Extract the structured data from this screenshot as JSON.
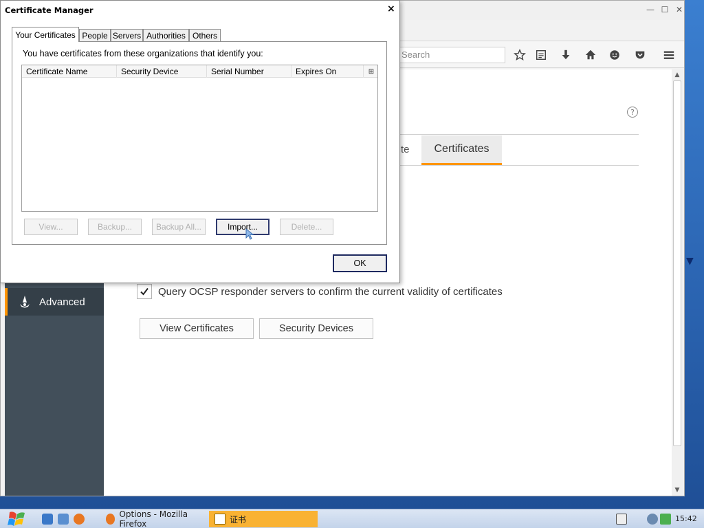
{
  "firefox": {
    "search_placeholder": "Search",
    "sidebar": {
      "advanced_label": "Advanced"
    },
    "tabs": {
      "partial_label": "te",
      "certificates_label": "Certificates"
    },
    "help_glyph": "?",
    "ocsp_label": "Query OCSP responder servers to confirm the current validity of certificates",
    "ocsp_checked": true,
    "buttons": {
      "view_certificates": "View Certificates",
      "security_devices": "Security Devices"
    }
  },
  "dialog": {
    "title": "Certificate Manager",
    "close_glyph": "×",
    "tabs": [
      "Your Certificates",
      "People",
      "Servers",
      "Authorities",
      "Others"
    ],
    "intro": "You have certificates from these organizations that identify you:",
    "columns": [
      "Certificate Name",
      "Security Device",
      "Serial Number",
      "Expires On"
    ],
    "buttons": {
      "view": "View...",
      "backup": "Backup...",
      "backup_all": "Backup All...",
      "import": "Import...",
      "delete": "Delete..."
    },
    "ok": "OK"
  },
  "taskbar": {
    "items": [
      {
        "label": "Options - Mozilla Firefox"
      },
      {
        "label": "证书"
      }
    ],
    "clock": "15:42"
  },
  "colors": {
    "accent": "#ff9500",
    "sidebar": "#424f5a",
    "taskbar_active": "#f9b233"
  }
}
